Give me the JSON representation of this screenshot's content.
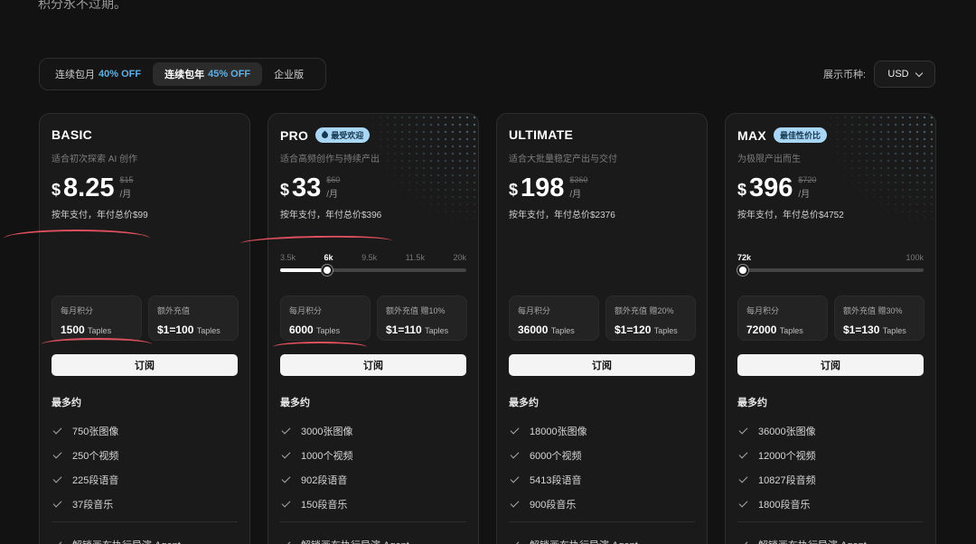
{
  "header": {
    "tagline": "积分永不过期。"
  },
  "tabs": [
    {
      "label": "连续包月",
      "off": "40% OFF"
    },
    {
      "label": "连续包年",
      "off": "45% OFF"
    },
    {
      "label": "企业版",
      "off": ""
    }
  ],
  "currency": {
    "label": "展示币种:",
    "value": "USD"
  },
  "common": {
    "subscribe_label": "订阅",
    "most_label": "最多约",
    "per_label": "/月",
    "currency_symbol": "$"
  },
  "plans": [
    {
      "name": "BASIC",
      "badge": "",
      "desc": "适合初次探索 AI 创作",
      "price": "8.25",
      "old_price": "$15",
      "annual": "按年支付，年付总价$99",
      "slider": null,
      "credits_label": "每月积分",
      "credits_value": "1500",
      "credits_unit": "Taples",
      "topup_label": "额外充值",
      "topup_value": "$1=100",
      "topup_unit": "Taples",
      "features": [
        "750张图像",
        "250个视频",
        "225段语音",
        "37段音乐"
      ],
      "extra": "解锁画布执行导演 Agent"
    },
    {
      "name": "PRO",
      "badge": "最受欢迎",
      "desc": "适合高频创作与持续产出",
      "price": "33",
      "old_price": "$60",
      "annual": "按年支付，年付总价$396",
      "slider": {
        "ticks": [
          "3.5k",
          "6k",
          "9.5k",
          "11.5k",
          "20k"
        ],
        "current": "6k",
        "fraction": 0.25
      },
      "credits_label": "每月积分",
      "credits_value": "6000",
      "credits_unit": "Taples",
      "topup_label": "额外充值 赠10%",
      "topup_value": "$1=110",
      "topup_unit": "Taples",
      "features": [
        "3000张图像",
        "1000个视频",
        "902段语音",
        "150段音乐"
      ],
      "extra": "解锁画布执行导演 Agent"
    },
    {
      "name": "ULTIMATE",
      "badge": "",
      "desc": "适合大批量稳定产出与交付",
      "price": "198",
      "old_price": "$360",
      "annual": "按年支付，年付总价$2376",
      "slider": null,
      "credits_label": "每月积分",
      "credits_value": "36000",
      "credits_unit": "Taples",
      "topup_label": "额外充值 赠20%",
      "topup_value": "$1=120",
      "topup_unit": "Taples",
      "features": [
        "18000张图像",
        "6000个视频",
        "5413段语音",
        "900段音乐"
      ],
      "extra": "解锁画布执行导演 Agent"
    },
    {
      "name": "MAX",
      "badge": "最佳性价比",
      "desc": "为极限产出而生",
      "price": "396",
      "old_price": "$720",
      "annual": "按年支付，年付总价$4752",
      "slider": {
        "current": "72k",
        "max": "100k",
        "fraction": 0
      },
      "credits_label": "每月积分",
      "credits_value": "72000",
      "credits_unit": "Taples",
      "topup_label": "额外充值 赠30%",
      "topup_value": "$1=130",
      "topup_unit": "Taples",
      "features": [
        "36000张图像",
        "12000个视频",
        "10827段音频",
        "1800段音乐"
      ],
      "extra": "解锁画布执行导演 Agent"
    }
  ],
  "colors": {
    "accent_off": "#5fb0e6",
    "badge_bg": "#a9d6f5",
    "annotation": "#e0505e"
  }
}
